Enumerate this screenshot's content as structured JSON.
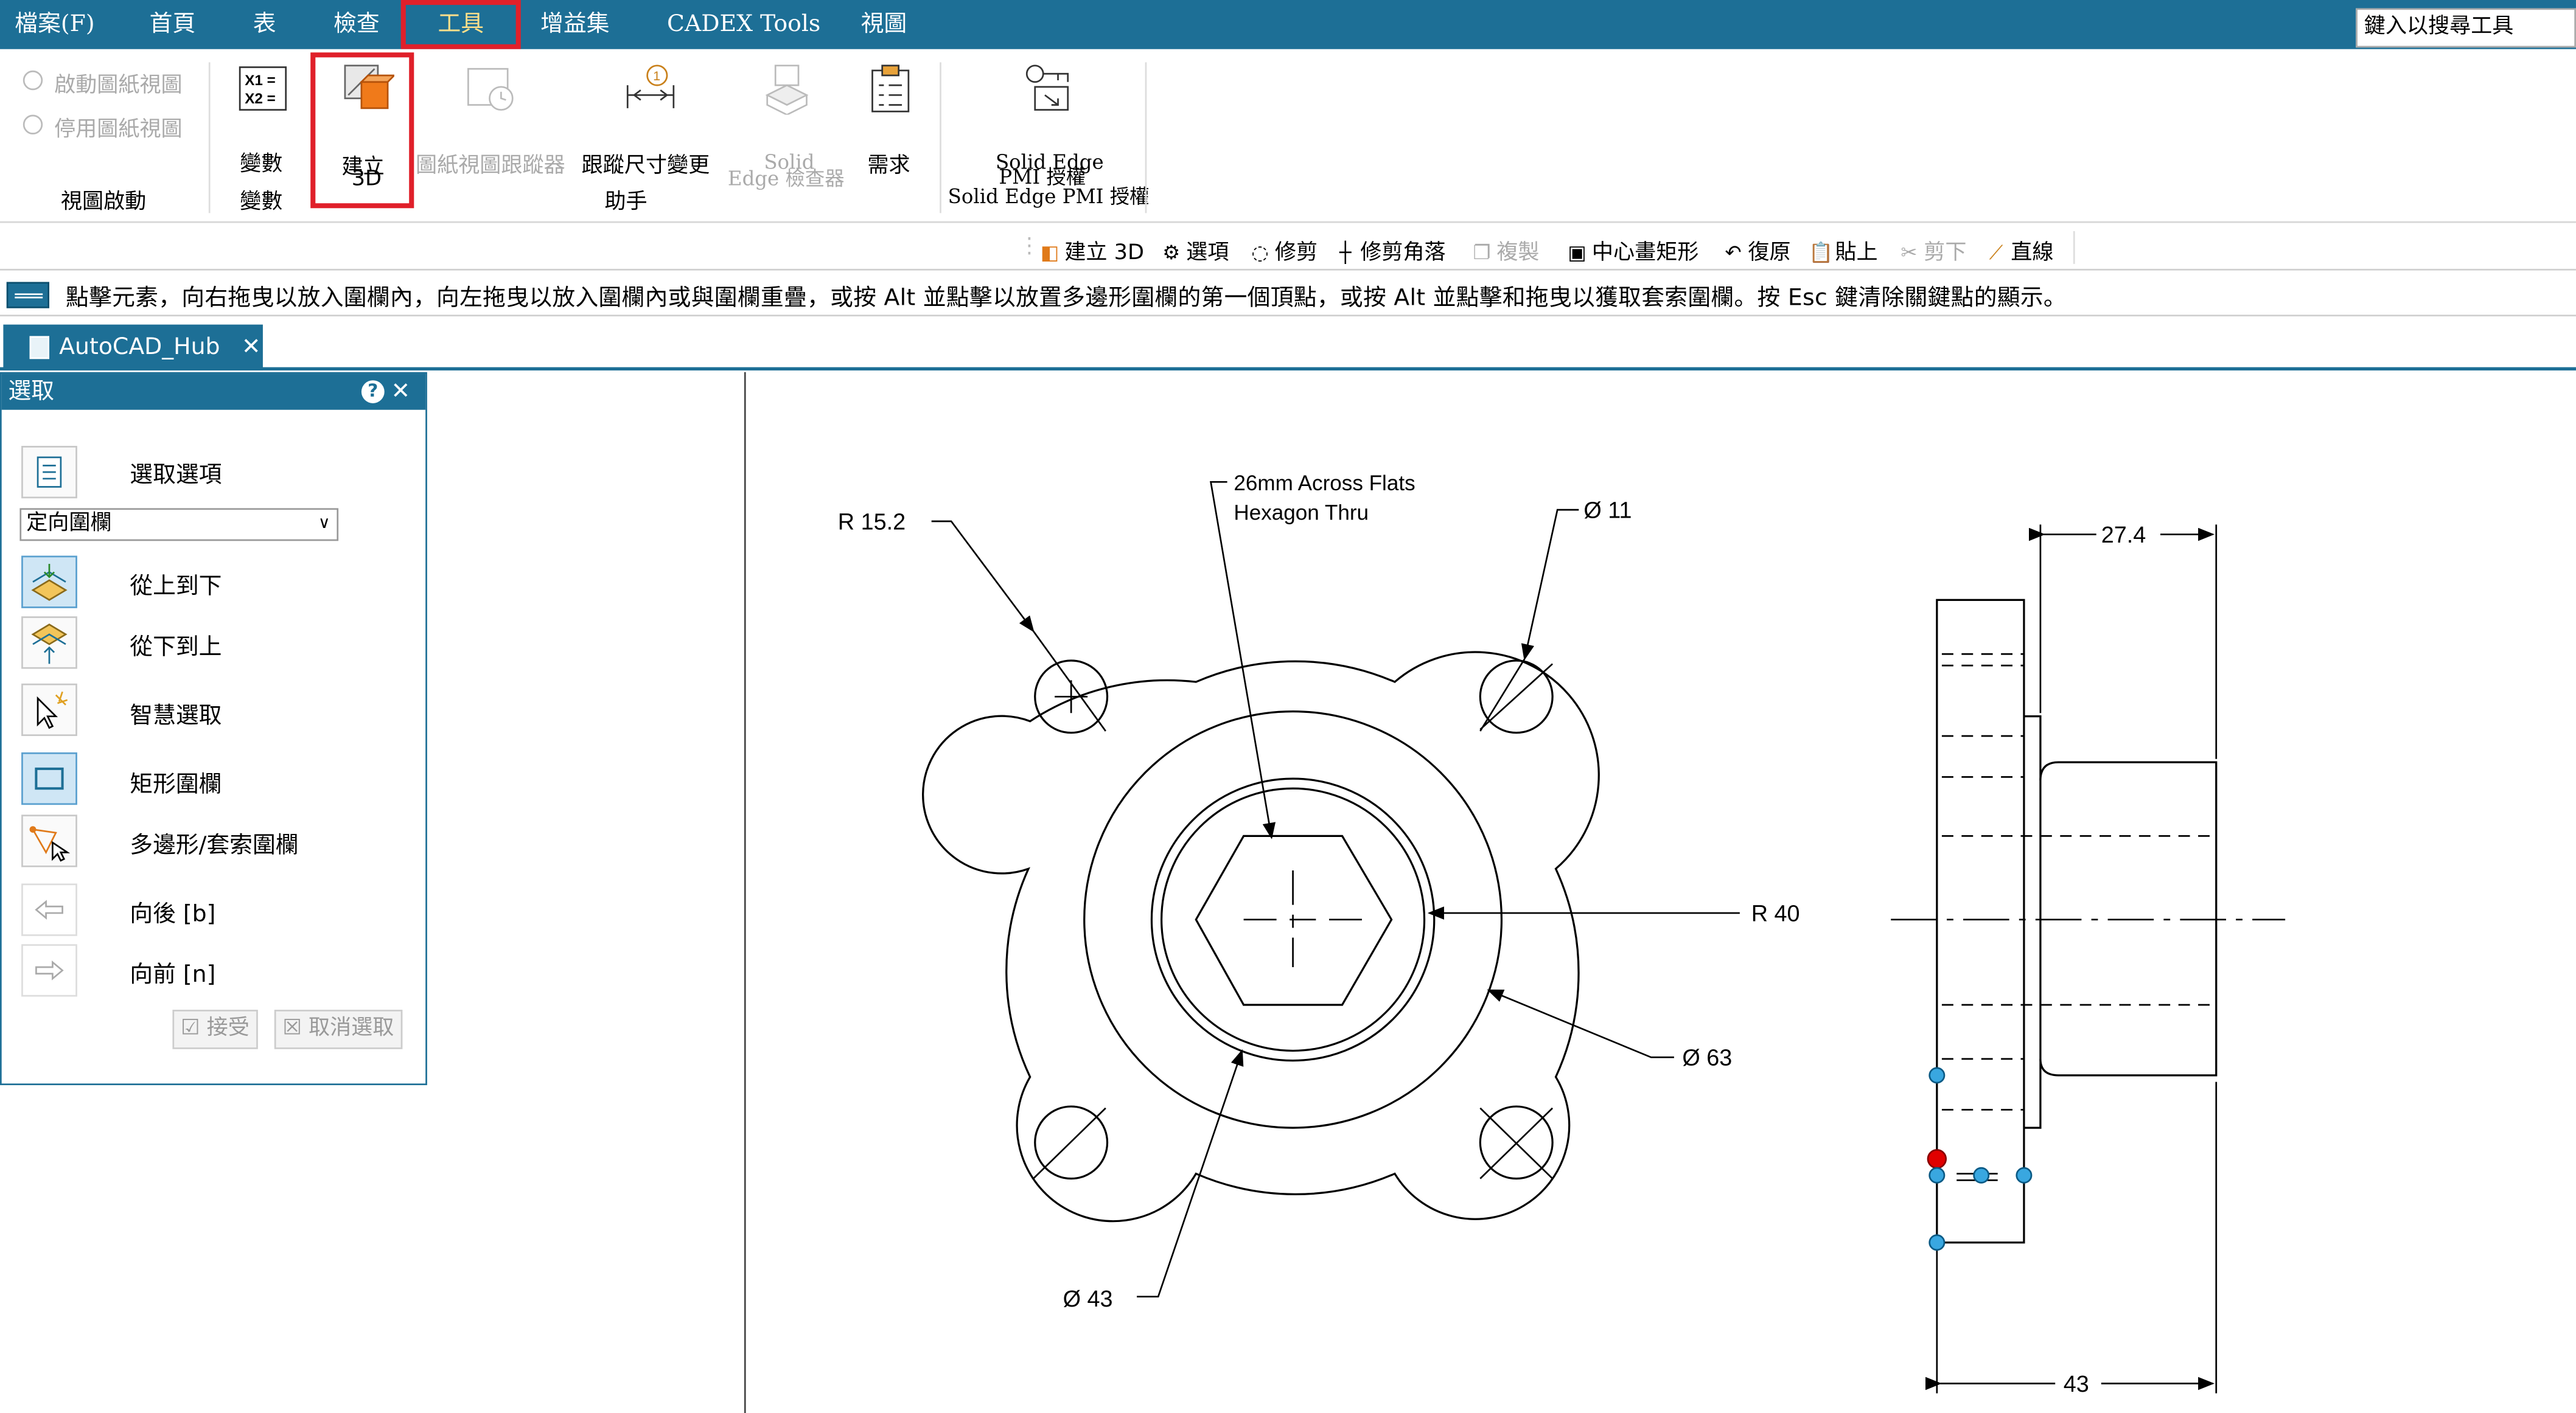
{
  "menubar": {
    "items": [
      "檔案(F)",
      "首頁",
      "表",
      "檢查",
      "工具",
      "增益集",
      "CADEX Tools",
      "視圖"
    ],
    "active": "工具",
    "search_placeholder": "鍵入以搜尋工具"
  },
  "ribbon": {
    "view_activation": {
      "activate": "啟動圖紙視圖",
      "deactivate": "停用圖紙視圖",
      "group_label": "視圖啟動"
    },
    "variables": {
      "label": "變數",
      "group_label": "變數"
    },
    "create3d": {
      "line1": "建立",
      "line2": "3D"
    },
    "drawing_view_tracker": "圖紙視圖跟蹤器",
    "dimension_tracker": "跟蹤尺寸變更",
    "assistant_group_label": "助手",
    "solid_edge_inspector": {
      "line1": "Solid",
      "line2": "Edge 檢查器"
    },
    "requirements": "需求",
    "pmi": {
      "line1": "Solid Edge",
      "line2": "PMI 授權",
      "group_label": "Solid Edge PMI 授權"
    }
  },
  "toolbar2": {
    "items": [
      {
        "label": "建立 3D",
        "icon": "create3d-icon",
        "enabled": true
      },
      {
        "label": "選項",
        "icon": "gear-icon",
        "enabled": true
      },
      {
        "label": "修剪",
        "icon": "trim-icon",
        "enabled": true
      },
      {
        "label": "修剪角落",
        "icon": "trim-corner-icon",
        "enabled": true
      },
      {
        "label": "複製",
        "icon": "copy-icon",
        "enabled": false
      },
      {
        "label": "中心畫矩形",
        "icon": "center-rectangle-icon",
        "enabled": true
      },
      {
        "label": "復原",
        "icon": "undo-icon",
        "enabled": true
      },
      {
        "label": "貼上",
        "icon": "paste-icon",
        "enabled": true
      },
      {
        "label": "剪下",
        "icon": "cut-icon",
        "enabled": false
      },
      {
        "label": "直線",
        "icon": "line-icon",
        "enabled": true
      }
    ]
  },
  "prompt": "點擊元素，向右拖曳以放入圍欄內，向左拖曳以放入圍欄內或與圍欄重疊，或按 Alt 並點擊以放置多邊形圍欄的第一個頂點，或按 Alt 並點擊和拖曳以獲取套索圍欄。按 Esc 鍵清除關鍵點的顯示。",
  "tab": {
    "title": "AutoCAD_Hub"
  },
  "panel": {
    "title": "選取",
    "select_options": "選取選項",
    "fence_mode": "定向圍欄",
    "top_to_bottom": "從上到下",
    "bottom_to_top": "從下到上",
    "smart_select": "智慧選取",
    "rect_fence": "矩形圍欄",
    "poly_fence": "多邊形/套索圍欄",
    "back": "向後 [b]",
    "forward": "向前 [n]",
    "accept": "接受",
    "deselect": "取消選取"
  },
  "drawing": {
    "dim_r152": "R  15.2",
    "note_line1": "26mm Across Flats",
    "note_line2": "Hexagon Thru",
    "dim_d11": "Ø  11",
    "dim_274": "27.4",
    "dim_r40": "R  40",
    "dim_d63": "Ø  63",
    "dim_d43": "Ø  43",
    "dim_43": "43"
  },
  "colors": {
    "accent": "#1d6f96",
    "highlight": "#e0202a",
    "active_menu_text": "#ffe08a",
    "handle": "#39a7e0",
    "handle_active": "#e00000"
  }
}
